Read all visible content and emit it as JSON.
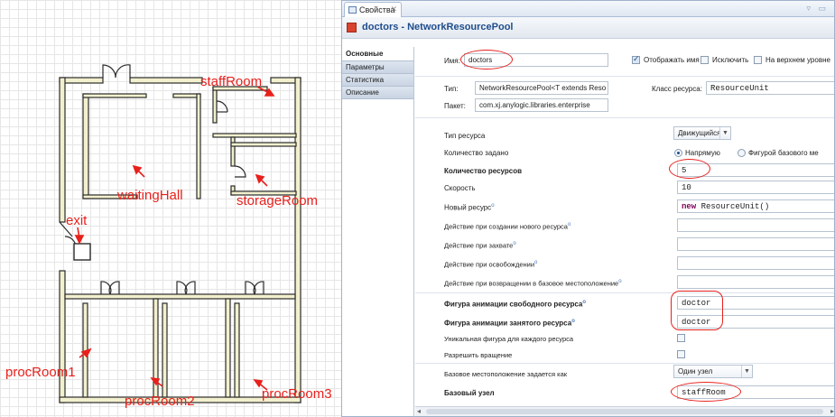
{
  "plan": {
    "labels": {
      "staff_room": "staffRoom",
      "waiting_hall": "waitingHall",
      "storage_room": "storageRoom",
      "exit": "exit",
      "proc_room1": "procRoom1",
      "proc_room2": "procRoom2",
      "proc_room3": "procRoom3"
    }
  },
  "panel": {
    "tab_label": "Свойства",
    "title": "doctors - NetworkResourcePool",
    "sidebar": {
      "items": [
        "Основные",
        "Параметры",
        "Статистика",
        "Описание"
      ],
      "active_index": 0
    },
    "name": {
      "label": "Имя:",
      "value": "doctors",
      "show_name_label": "Отображать имя",
      "show_name_checked": true,
      "exclude_label": "Исключить",
      "exclude_checked": false,
      "top_level_label": "На верхнем уровне",
      "top_level_checked": false
    },
    "type": {
      "label": "Тип:",
      "value": "NetworkResourcePool<T extends Reso",
      "resource_class_label": "Класс ресурса:",
      "resource_class_value": "ResourceUnit",
      "package_label": "Пакет:",
      "package_value": "com.xj.anylogic.libraries.enterprise"
    },
    "props": {
      "resource_type_label": "Тип ресурса",
      "resource_type_value": "Движущийся",
      "count_given_label": "Количество задано",
      "count_direct_label": "Напрямую",
      "count_direct_selected": true,
      "count_shape_label": "Фигурой базового ме",
      "resource_count_label": "Количество ресурсов",
      "resource_count_value": "5",
      "speed_label": "Скорость",
      "speed_value": "10",
      "new_resource_label": "Новый ресурс",
      "new_resource_kw": "new",
      "new_resource_value": "ResourceUnit()",
      "on_create_label": "Действие при создании нового ресурса",
      "on_seize_label": "Действие при захвате",
      "on_release_label": "Действие при освобождении",
      "on_return_label": "Действие при возвращении в базовое местоположение",
      "idle_shape_label": "Фигура анимации свободного ресурса",
      "idle_shape_value": "doctor",
      "busy_shape_label": "Фигура анимации занятого ресурса",
      "busy_shape_value": "doctor",
      "unique_shape_label": "Уникальная фигура для каждого ресурса",
      "unique_shape_checked": false,
      "allow_rotation_label": "Разрешить вращение",
      "allow_rotation_checked": false,
      "home_location_label": "Базовое местоположение задается как",
      "home_location_value": "Один узел",
      "home_node_label": "Базовый узел",
      "home_node_value": "staffRoom"
    }
  },
  "colors": {
    "annotation_red": "#e8201c",
    "title_blue": "#1f4d8c",
    "wall": "#2b2b2b",
    "wall_fill": "#f3f0cf"
  }
}
